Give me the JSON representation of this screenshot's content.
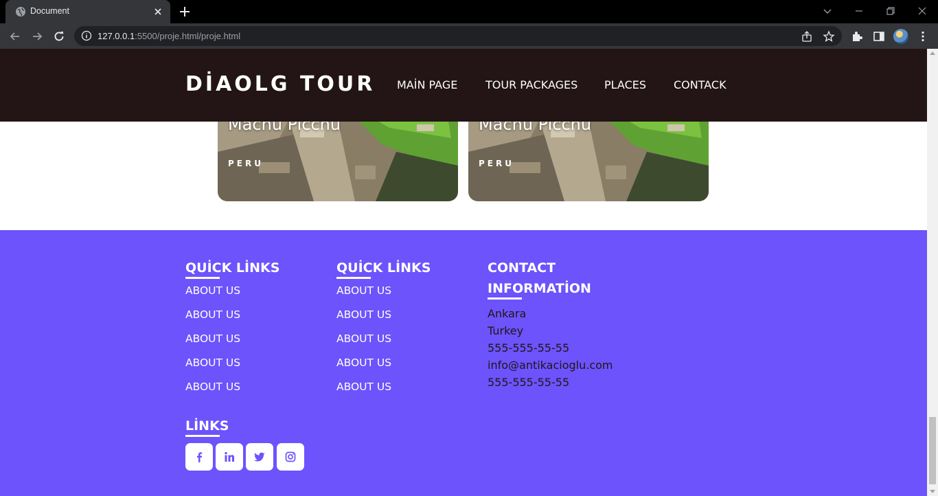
{
  "browser": {
    "tab_title": "Document",
    "url_host": "127.0.0.1",
    "url_rest": ":5500/proje.html/proje.html"
  },
  "header": {
    "logo": "DİAOLG TOUR",
    "nav": [
      "MAİN PAGE",
      "TOUR PACKAGES",
      "PLACES",
      "CONTACK"
    ]
  },
  "cards": [
    {
      "name": "Machu Picchu",
      "country": "PERU"
    },
    {
      "name": "Machu Picchu",
      "country": "PERU"
    }
  ],
  "footer": {
    "col1": {
      "title": "QUİCK LİNKS",
      "links": [
        "ABOUT US",
        "ABOUT US",
        "ABOUT US",
        "ABOUT US",
        "ABOUT US"
      ]
    },
    "col2": {
      "title": "QUİCK LİNKS",
      "links": [
        "ABOUT US",
        "ABOUT US",
        "ABOUT US",
        "ABOUT US",
        "ABOUT US"
      ]
    },
    "contact": {
      "title_line1": "CONTACT",
      "title_line2": "INFORMATİON",
      "lines": [
        "Ankara",
        "Turkey",
        "555-555-55-55",
        "info@antikacioglu.com",
        "555-555-55-55"
      ]
    },
    "links_title": "LİNKS",
    "socials": [
      "facebook-icon",
      "linkedin-icon",
      "twitter-icon",
      "instagram-icon"
    ]
  },
  "colors": {
    "header_bg": "#231515",
    "footer_bg": "#6c53fc",
    "contact_text": "#231515"
  }
}
